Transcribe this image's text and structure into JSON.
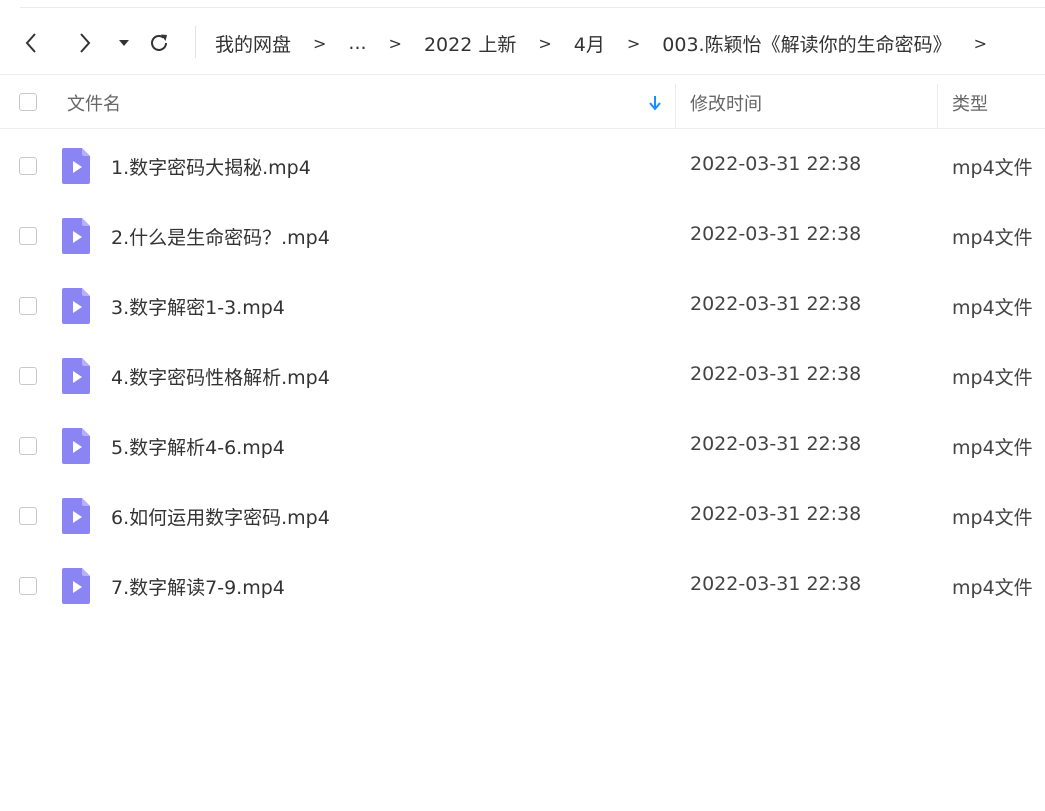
{
  "breadcrumb": [
    {
      "label": "我的网盘"
    },
    {
      "label": "..."
    },
    {
      "label": "2022 上新"
    },
    {
      "label": "4月"
    },
    {
      "label": "003.陈颖怡《解读你的生命密码》"
    }
  ],
  "breadcrumb_separator": ">",
  "table": {
    "columns": {
      "name": "文件名",
      "modified": "修改时间",
      "type": "类型"
    },
    "rows": [
      {
        "name": "1.数字密码大揭秘.mp4",
        "modified": "2022-03-31 22:38",
        "type": "mp4文件"
      },
      {
        "name": "2.什么是生命密码？.mp4",
        "modified": "2022-03-31 22:38",
        "type": "mp4文件"
      },
      {
        "name": "3.数字解密1-3.mp4",
        "modified": "2022-03-31 22:38",
        "type": "mp4文件"
      },
      {
        "name": "4.数字密码性格解析.mp4",
        "modified": "2022-03-31 22:38",
        "type": "mp4文件"
      },
      {
        "name": "5.数字解析4-6.mp4",
        "modified": "2022-03-31 22:38",
        "type": "mp4文件"
      },
      {
        "name": "6.如何运用数字密码.mp4",
        "modified": "2022-03-31 22:38",
        "type": "mp4文件"
      },
      {
        "name": "7.数字解读7-9.mp4",
        "modified": "2022-03-31 22:38",
        "type": "mp4文件"
      }
    ]
  },
  "icons": {
    "back": "chevron-left-icon",
    "forward": "chevron-right-icon",
    "history": "caret-down-icon",
    "refresh": "refresh-icon",
    "sort": "arrow-down-icon",
    "file": "video-file-icon"
  },
  "colors": {
    "accent": "#1a8cfe",
    "video_icon": "#8b84f3"
  }
}
